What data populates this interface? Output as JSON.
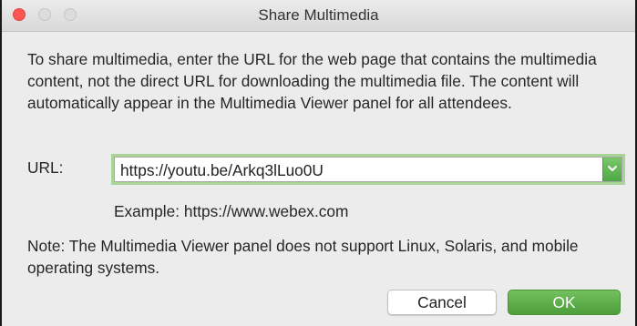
{
  "window": {
    "title": "Share Multimedia",
    "controls": [
      "close",
      "minimize",
      "maximize"
    ]
  },
  "description": "To share multimedia, enter the URL for the web page that contains the multimedia content, not the direct URL for downloading the multimedia file. The content will automatically appear in the Multimedia Viewer panel for all attendees.",
  "url": {
    "label": "URL:",
    "value": "https://youtu.be/Arkq3lLuo0U",
    "dropdown_icon": "chevron-down-icon"
  },
  "example": "Example: https://www.webex.com",
  "note": "Note: The Multimedia Viewer panel does not support Linux, Solaris, and mobile operating systems.",
  "buttons": {
    "cancel": "Cancel",
    "ok": "OK"
  },
  "colors": {
    "accent": "#5aae48",
    "close": "#fc5753",
    "focus_ring": "#a8d596"
  }
}
